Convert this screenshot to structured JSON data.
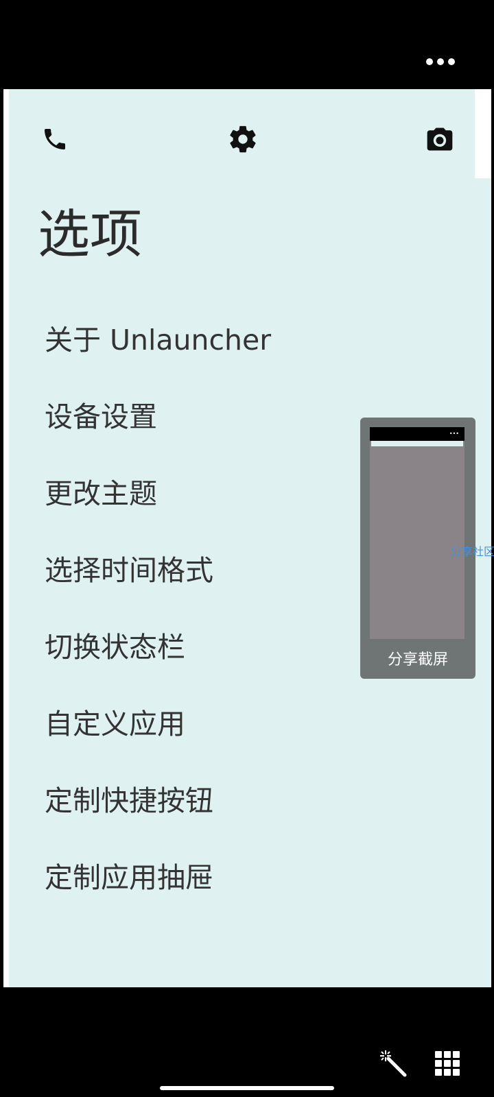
{
  "header": {
    "more_menu": "more-options"
  },
  "toolbar": {
    "icons": [
      "phone-icon",
      "gear-icon",
      "camera-icon"
    ]
  },
  "page": {
    "title": "选项"
  },
  "menu": {
    "items": [
      {
        "label": "关于 Unlauncher"
      },
      {
        "label": "设备设置"
      },
      {
        "label": "更改主题"
      },
      {
        "label": "选择时间格式"
      },
      {
        "label": "切换状态栏"
      },
      {
        "label": "自定义应用"
      },
      {
        "label": "定制快捷按钮"
      },
      {
        "label": "定制应用抽屉"
      }
    ]
  },
  "share_overlay": {
    "label": "分享截屏",
    "side_link": "分享社区"
  },
  "bottom_bar": {
    "icons": [
      "magic-wand-icon",
      "grid-icon"
    ]
  },
  "colors": {
    "panel_bg": "#dff1f1",
    "text": "#333333",
    "overlay_bg": "#6f7575",
    "link": "#4a90d9"
  }
}
